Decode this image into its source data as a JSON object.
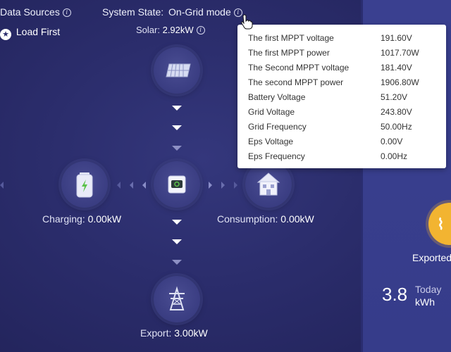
{
  "header": {
    "data_sources_label": "Data Sources",
    "system_state_label": "System State:",
    "system_state_value": "On-Grid mode",
    "load_first_label": "Load First",
    "info_icon_glyph": "i",
    "star_glyph": "★"
  },
  "solar": {
    "label": "Solar:",
    "value": "2.92kW"
  },
  "battery": {
    "label": "Charging:",
    "value": "0.00kW"
  },
  "consumption": {
    "label": "Consumption:",
    "value": "0.00kW"
  },
  "grid": {
    "label": "Export:",
    "value": "3.00kW"
  },
  "tooltip": {
    "rows": [
      {
        "label": "The first MPPT voltage",
        "value": "191.60V"
      },
      {
        "label": "The first MPPT power",
        "value": "1017.70W"
      },
      {
        "label": "The Second MPPT voltage",
        "value": "181.40V"
      },
      {
        "label": "The second MPPT power",
        "value": "1906.80W"
      },
      {
        "label": "Battery Voltage",
        "value": "51.20V"
      },
      {
        "label": "Grid Voltage",
        "value": "243.80V"
      },
      {
        "label": "Grid Frequency",
        "value": "50.00Hz"
      },
      {
        "label": "Eps Voltage",
        "value": "0.00V"
      },
      {
        "label": "Eps Frequency",
        "value": "0.00Hz"
      }
    ]
  },
  "right_panel": {
    "exported_label": "Exported",
    "energy_value": "3.8",
    "period_label": "Today",
    "unit_label": "kWh"
  },
  "colors": {
    "background": "#2b2d6c",
    "panel": "#3a4090",
    "accent_yellow": "#f2b431",
    "battery_green": "#5bc24a"
  },
  "icons": {
    "solar": "solar-panel-icon",
    "battery": "battery-icon",
    "inverter": "inverter-icon",
    "house": "house-icon",
    "grid": "grid-tower-icon"
  }
}
